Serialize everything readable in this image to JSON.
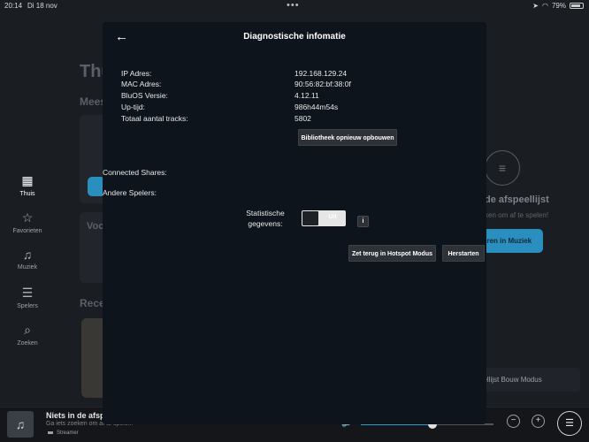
{
  "status_bar": {
    "time": "20:14",
    "date": "Di 18 nov",
    "battery": "79%"
  },
  "background": {
    "heading_partial": "Thu",
    "section_partial_1": "Mees",
    "section_partial_2": "Voc",
    "section_partial_3": "Rece",
    "right_title": "de afspeellijst",
    "right_subtitle": "ken om af te spelen!",
    "right_button": "eren in Muziek",
    "bouw_card": "pellijst Bouw Modus"
  },
  "sidebar": {
    "items": [
      {
        "label": "Thuis",
        "icon": "home-icon"
      },
      {
        "label": "Favorieten",
        "icon": "star-icon"
      },
      {
        "label": "Muziek",
        "icon": "music-note-icon"
      },
      {
        "label": "Spelers",
        "icon": "players-icon"
      },
      {
        "label": "Zoeken",
        "icon": "search-icon"
      }
    ]
  },
  "player": {
    "title": "Niets in de afsp",
    "subtitle": "Ga iets zoeken om af te spelen!",
    "device": "Streamer",
    "volume_level": 0.54
  },
  "modal": {
    "title": "Diagnostische infomatie",
    "info": [
      {
        "label": "IP Adres:",
        "value": "192.168.129.24"
      },
      {
        "label": "MAC Adres:",
        "value": "90:56:82:bf:38:0f"
      },
      {
        "label": "BluOS Versie:",
        "value": "4.12.11"
      },
      {
        "label": "Up-tijd:",
        "value": "986h44m54s"
      },
      {
        "label": "Totaal aantal tracks:",
        "value": "5802"
      }
    ],
    "rebuild_button": "Bibliotheek opnieuw opbouwen",
    "connected_shares": "Connected Shares:",
    "other_players": "Andere Spelers:",
    "stats_label": "Statistische gegevens:",
    "stats_toggle": "Uit",
    "info_button": "i",
    "hotspot_button": "Zet terug in Hotspot Modus",
    "restart_button": "Herstarten"
  }
}
